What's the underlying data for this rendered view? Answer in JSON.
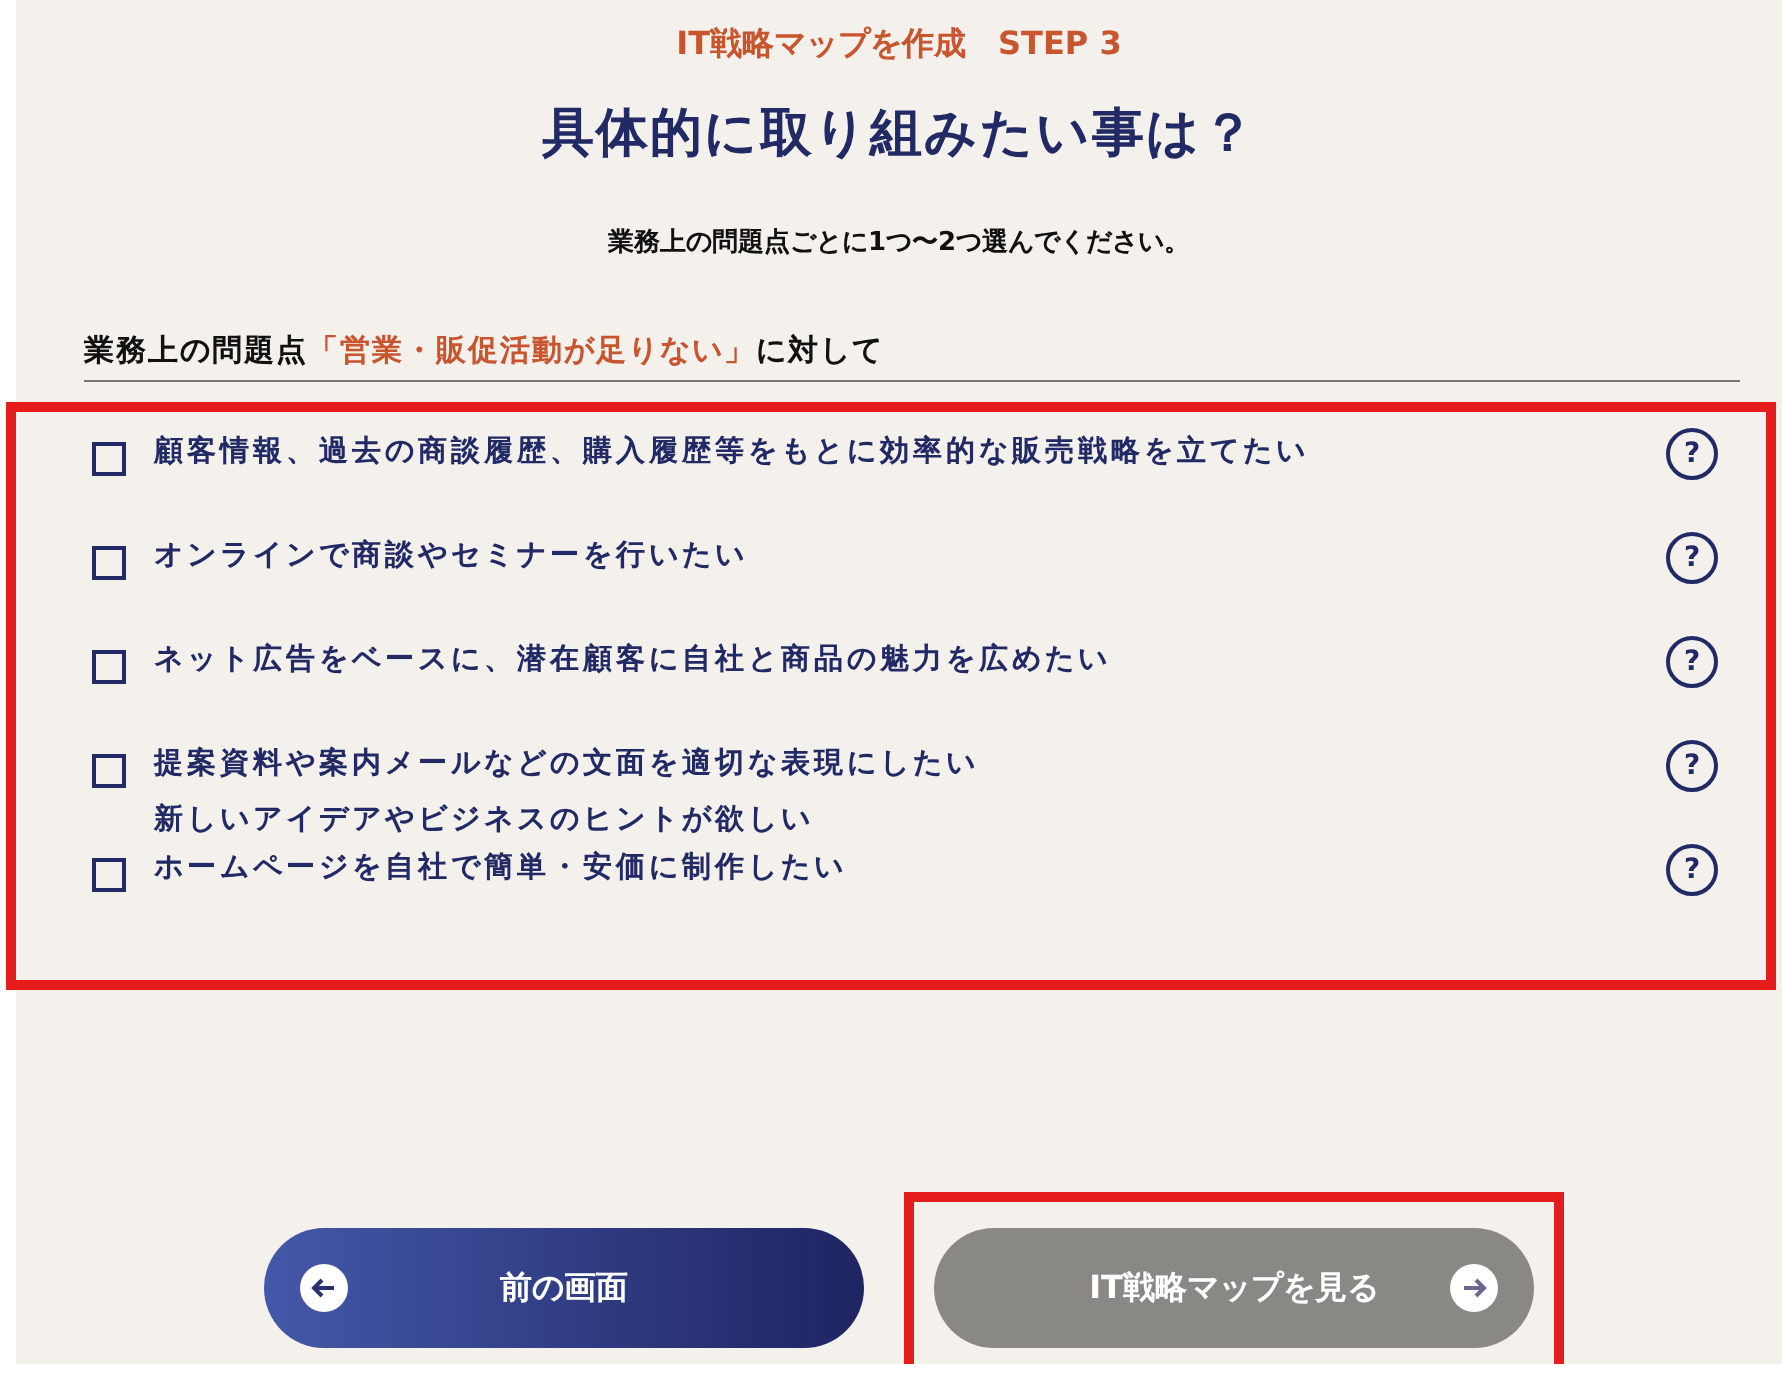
{
  "step_label": "IT戦略マップを作成　STEP 3",
  "title": "具体的に取り組みたい事は？",
  "instruction": "業務上の問題点ごとに1つ〜2つ選んでください。",
  "problem_heading": {
    "prefix": "業務上の問題点",
    "problem": "「営業・販促活動が足りない」",
    "suffix": "に対して"
  },
  "options": [
    {
      "lines": [
        "顧客情報、過去の商談履歴、購入履歴等をもとに効率的な販売戦略を立てたい"
      ],
      "checked": false
    },
    {
      "lines": [
        "オンラインで商談やセミナーを行いたい"
      ],
      "checked": false
    },
    {
      "lines": [
        "ネット広告をベースに、潜在顧客に自社と商品の魅力を広めたい"
      ],
      "checked": false
    },
    {
      "lines": [
        "提案資料や案内メールなどの文面を適切な表現にしたい",
        "新しいアイデアやビジネスのヒントが欲しい"
      ],
      "checked": false
    },
    {
      "lines": [
        "ホームページを自社で簡単・安価に制作したい"
      ],
      "checked": false
    }
  ],
  "help_icon_text": "?",
  "buttons": [
    {
      "kind": "back",
      "label": "前の画面",
      "disabled": false,
      "highlighted": false
    },
    {
      "kind": "next",
      "label": "IT戦略マップを見る",
      "disabled": true,
      "highlighted": true
    }
  ],
  "options_highlighted": true
}
